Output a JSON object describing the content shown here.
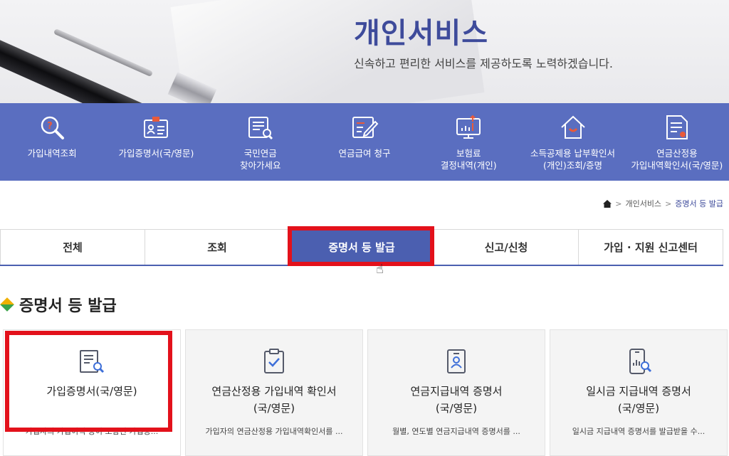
{
  "hero": {
    "title": "개인서비스",
    "subtitle": "신속하고 편리한 서비스를 제공하도록 노력하겠습니다."
  },
  "quick_menu": [
    {
      "icon": "search-icon",
      "label": "가입내역조회"
    },
    {
      "icon": "id-card-icon",
      "label": "가입증명서(국/영문)"
    },
    {
      "icon": "document-search-icon",
      "label": "국민연금\n찾아가세요"
    },
    {
      "icon": "edit-document-icon",
      "label": "연금급여 청구"
    },
    {
      "icon": "monitor-chart-icon",
      "label": "보험료\n결정내역(개인)"
    },
    {
      "icon": "house-icon",
      "label": "소득공제용 납부확인서\n(개인)조회/증명"
    },
    {
      "icon": "document-icon",
      "label": "연금산정용\n가입내역확인서(국/영문)"
    }
  ],
  "breadcrumb": {
    "home_icon": "home-icon",
    "items": [
      "개인서비스",
      "증명서 등 발급"
    ]
  },
  "tabs": [
    {
      "label": "전체",
      "active": false
    },
    {
      "label": "조회",
      "active": false
    },
    {
      "label": "증명서 등 발급",
      "active": true
    },
    {
      "label": "신고/신청",
      "active": false
    },
    {
      "label": "가입 · 지원 신고센터",
      "active": false
    }
  ],
  "section": {
    "title": "증명서 등 발급"
  },
  "cards": [
    {
      "icon": "document-search-icon",
      "title": "가입증명서(국/영문)",
      "desc": "가입자의 가입이력 등이 포함된 가입증..."
    },
    {
      "icon": "clipboard-check-icon",
      "title": "연금산정용 가입내역 확인서\n(국/영문)",
      "desc": "가입자의 연금산정용 가입내역확인서를 ..."
    },
    {
      "icon": "badge-person-icon",
      "title": "연금지급내역 증명서\n(국/영문)",
      "desc": "월별, 연도별 연금지급내역 증명서를 ..."
    },
    {
      "icon": "phone-search-icon",
      "title": "일시금 지급내역 증명서\n(국/영문)",
      "desc": "일시금 지급내역 증명서를 발급받을 수..."
    }
  ],
  "colors": {
    "brand": "#5a6ec0",
    "tab_active": "#4b5fb0",
    "title": "#3e4b9b",
    "highlight": "#e3111b"
  }
}
